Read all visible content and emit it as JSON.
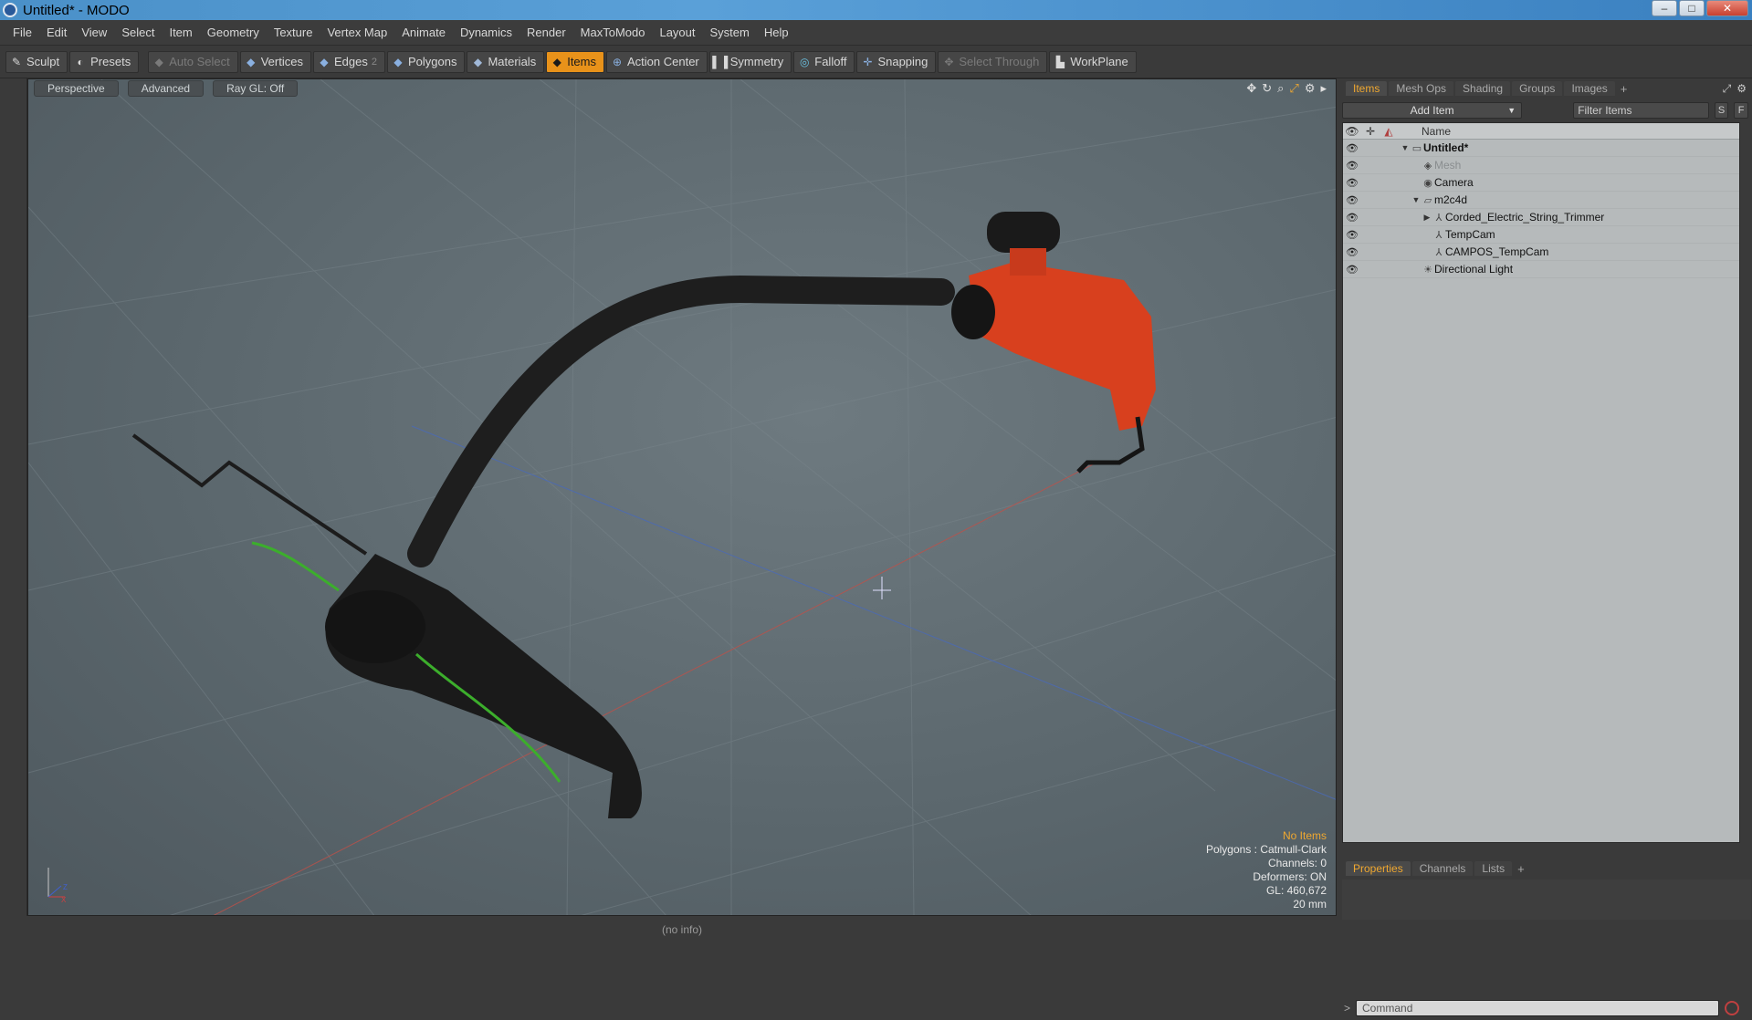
{
  "window": {
    "title": "Untitled* - MODO",
    "minimize": "–",
    "maximize": "□",
    "close": "✕"
  },
  "menu": [
    "File",
    "Edit",
    "View",
    "Select",
    "Item",
    "Geometry",
    "Texture",
    "Vertex Map",
    "Animate",
    "Dynamics",
    "Render",
    "MaxToModo",
    "Layout",
    "System",
    "Help"
  ],
  "toolbar": {
    "sculpt": "Sculpt",
    "presets": "Presets",
    "auto_select": "Auto Select",
    "vertices": "Vertices",
    "edges": "Edges",
    "edges_count": "2",
    "polygons": "Polygons",
    "materials": "Materials",
    "items": "Items",
    "action_center": "Action Center",
    "symmetry": "Symmetry",
    "falloff": "Falloff",
    "snapping": "Snapping",
    "select_through": "Select Through",
    "workplane": "WorkPlane"
  },
  "viewport": {
    "view": "Perspective",
    "mode": "Advanced",
    "raygl": "Ray GL: Off",
    "info": {
      "no_items": "No Items",
      "polygons": "Polygons : Catmull-Clark",
      "channels": "Channels: 0",
      "deformers": "Deformers: ON",
      "gl": "GL: 460,672",
      "scale": "20 mm"
    },
    "axis": {
      "x": "X",
      "z": "Z"
    }
  },
  "status": {
    "text": "(no info)"
  },
  "panel": {
    "tabs": [
      "Items",
      "Mesh Ops",
      "Shading",
      "Groups",
      "Images"
    ],
    "add_item": "Add Item",
    "filter_placeholder": "Filter Items",
    "s_btn": "S",
    "f_btn": "F",
    "column_name": "Name",
    "tree": [
      {
        "label": "Untitled*",
        "depth": 0,
        "toggle": "▼",
        "icon": "scene-icon",
        "bold": true
      },
      {
        "label": "Mesh",
        "depth": 1,
        "toggle": "",
        "icon": "mesh-icon",
        "dim": true
      },
      {
        "label": "Camera",
        "depth": 1,
        "toggle": "",
        "icon": "camera-icon"
      },
      {
        "label": "m2c4d",
        "depth": 1,
        "toggle": "▼",
        "icon": "group-icon"
      },
      {
        "label": "Corded_Electric_String_Trimmer",
        "depth": 2,
        "toggle": "▶",
        "icon": "locator-icon"
      },
      {
        "label": "TempCam",
        "depth": 2,
        "toggle": "",
        "icon": "locator-icon"
      },
      {
        "label": "CAMPOS_TempCam",
        "depth": 2,
        "toggle": "",
        "icon": "locator-icon"
      },
      {
        "label": "Directional Light",
        "depth": 1,
        "toggle": "",
        "icon": "light-icon"
      }
    ]
  },
  "properties": {
    "tabs": [
      "Properties",
      "Channels",
      "Lists"
    ]
  },
  "command": {
    "placeholder": "Command",
    "prompt": ">"
  }
}
